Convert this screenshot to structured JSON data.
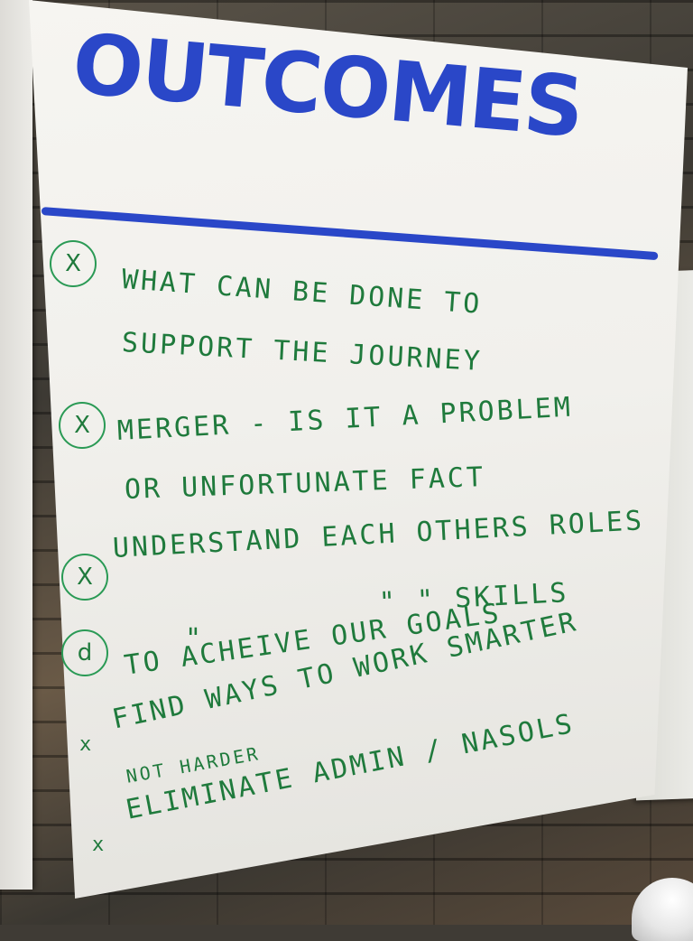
{
  "title": "OUTCOMES",
  "items": [
    {
      "marker": "X",
      "lines": [
        "WHAT CAN BE DONE TO",
        "SUPPORT THE JOURNEY"
      ]
    },
    {
      "marker": "X",
      "lines": [
        "MERGER - IS IT A PROBLEM",
        "OR UNFORTUNATE FACT"
      ]
    },
    {
      "marker": "X",
      "lines": [
        "UNDERSTAND EACH OTHERS ROLES",
        "\"      \"      SKILLS"
      ]
    },
    {
      "marker": "d",
      "lines": [
        "\"",
        "TO ACHEIVE OUR GOALS"
      ]
    },
    {
      "marker": "x",
      "lines": [
        "FIND WAYS TO WORK SMARTER",
        "NOT HARDER"
      ],
      "struck": "HARDER"
    },
    {
      "marker": "x",
      "lines": [
        "ELIMINATE ADMIN / NASOLS"
      ]
    }
  ],
  "colors": {
    "title_ink": "#2a47c8",
    "body_ink": "#1f7a3c",
    "paper": "#f3f2ee"
  }
}
